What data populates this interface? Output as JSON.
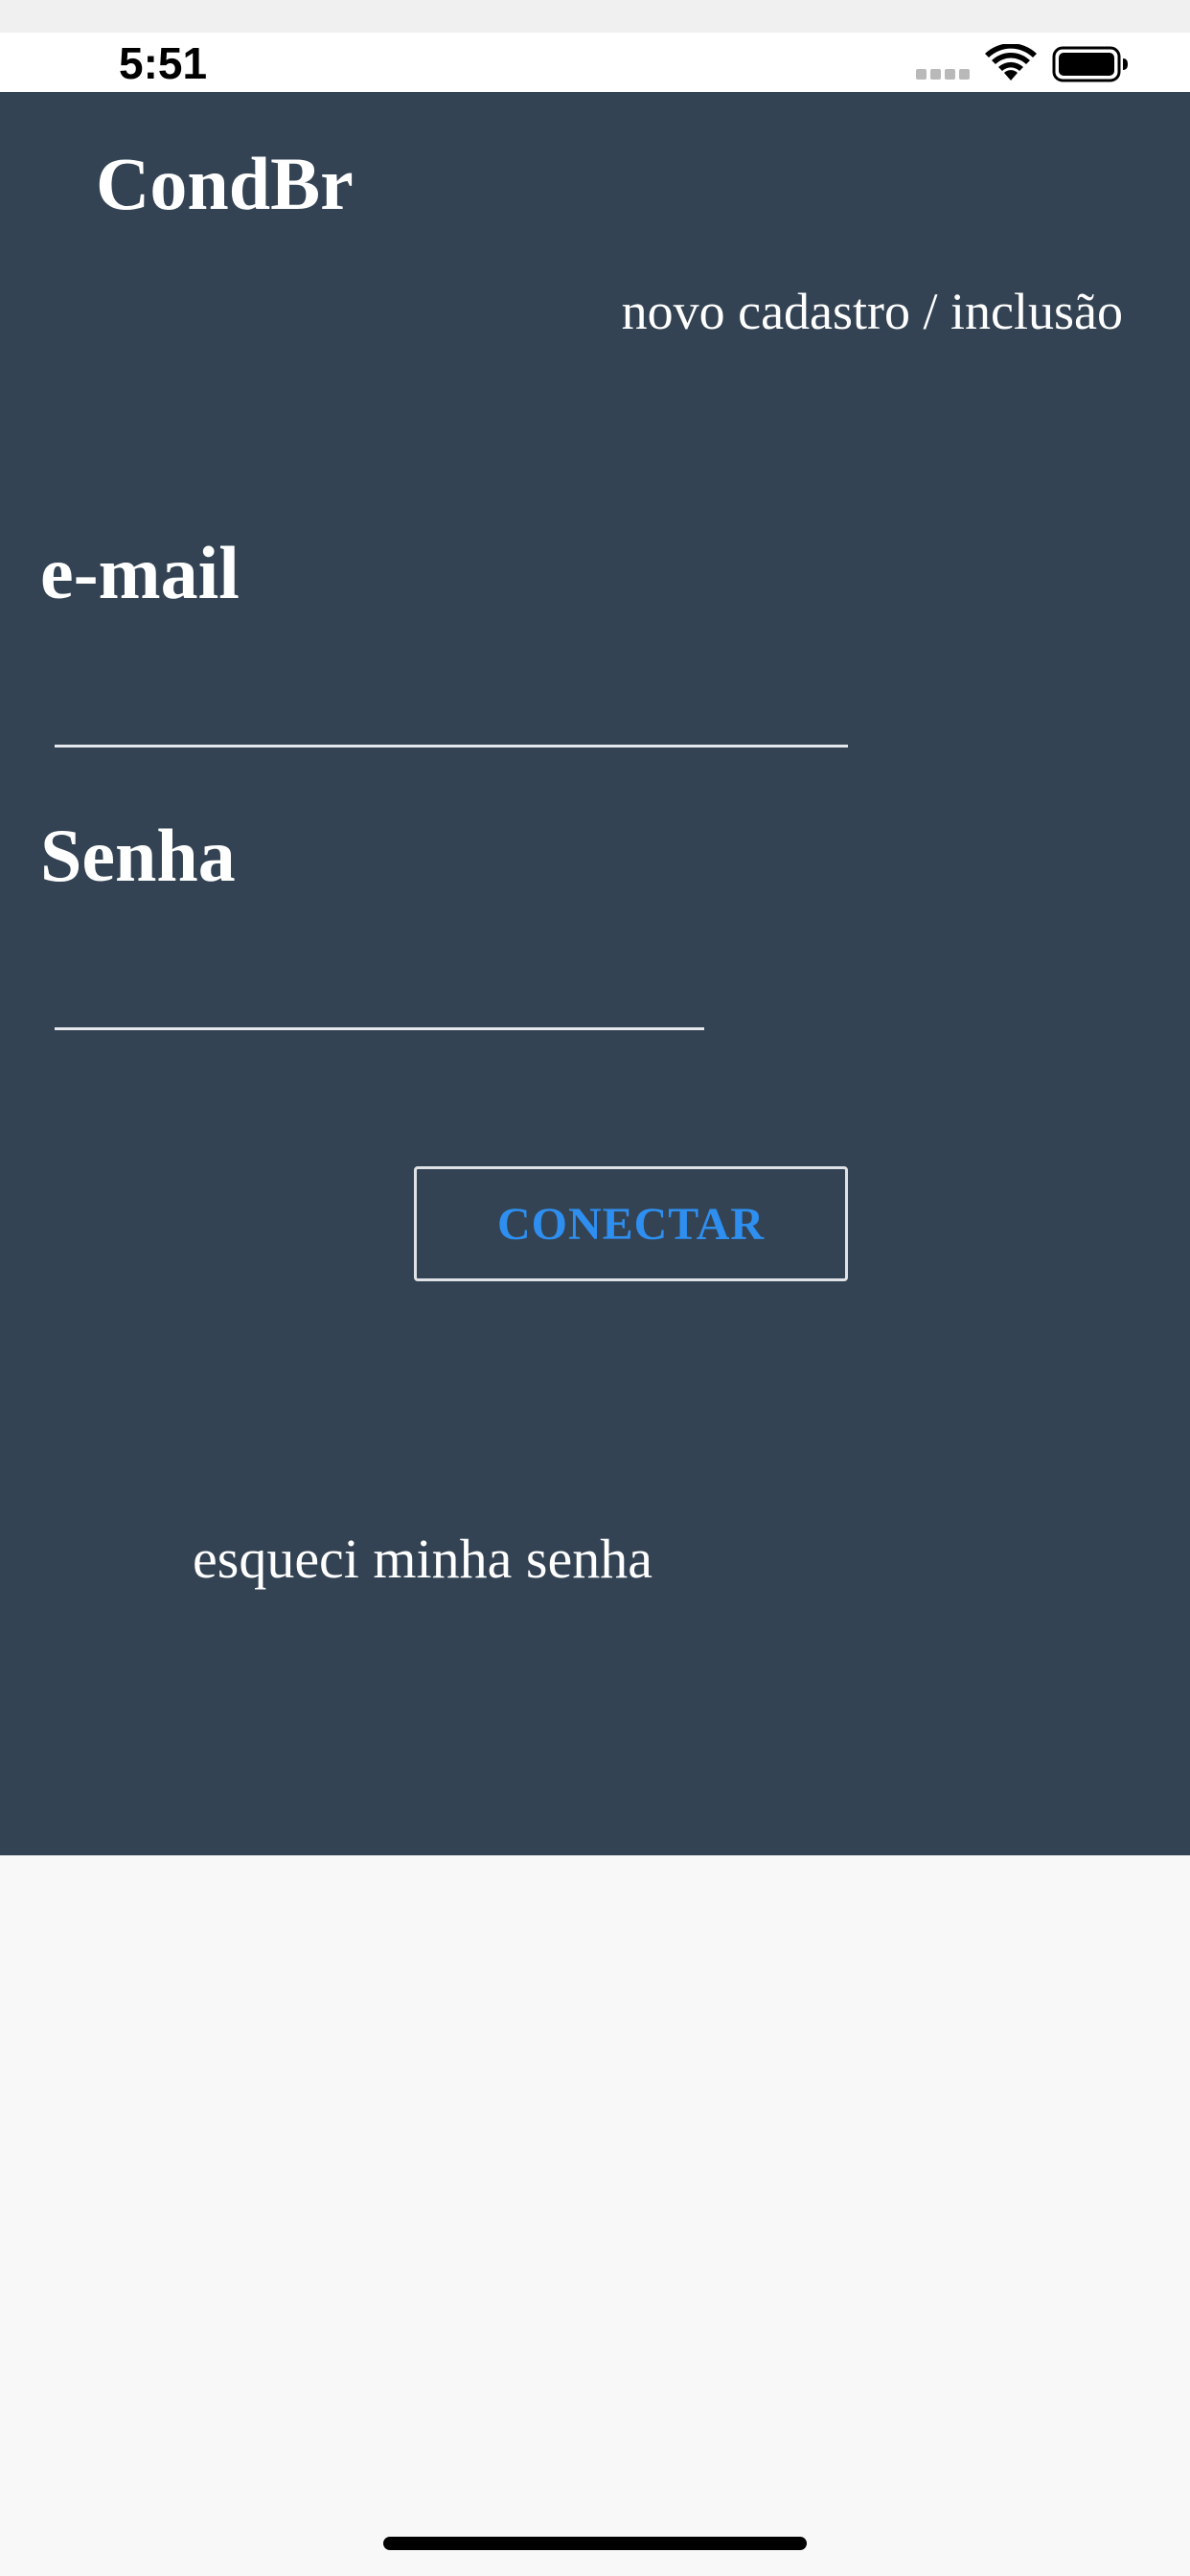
{
  "status_bar": {
    "time": "5:51",
    "icons": [
      "signal-dots-icon",
      "wifi-icon",
      "battery-icon"
    ]
  },
  "header": {
    "title": "CondBr",
    "register_link": "novo cadastro / inclusão"
  },
  "login_form": {
    "email_label": "e-mail",
    "email_value": "",
    "password_label": "Senha",
    "password_value": "",
    "connect_button": "CONECTAR",
    "forgot_password_link": "esqueci minha senha"
  },
  "colors": {
    "panel_background": "#334353",
    "page_background": "#f8f8f8",
    "button_text": "#2e8ff0",
    "text": "#ffffff"
  }
}
